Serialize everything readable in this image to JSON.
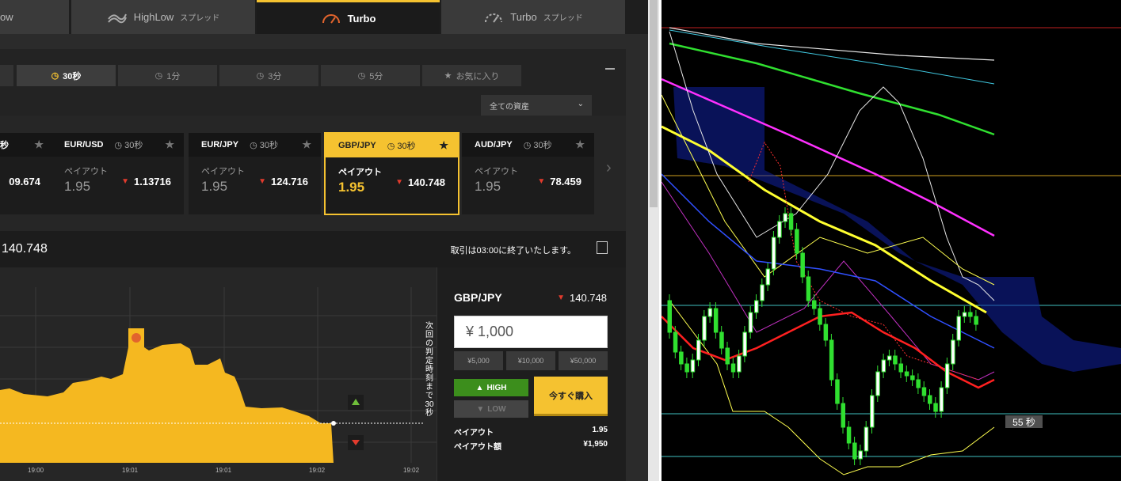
{
  "top_tabs": [
    {
      "label": "ow",
      "sub": ""
    },
    {
      "label": "HighLow",
      "sub": "スプレッド"
    },
    {
      "label": "Turbo",
      "sub": ""
    },
    {
      "label": "Turbo",
      "sub": "スプレッド"
    }
  ],
  "durations": [
    {
      "label": "30秒"
    },
    {
      "label": "1分"
    },
    {
      "label": "3分"
    },
    {
      "label": "5分"
    },
    {
      "label": "お気に入り"
    }
  ],
  "asset_filter": "全ての資産",
  "assets": [
    {
      "pair": "",
      "duration": "秒",
      "payout_label": "",
      "payout": "",
      "rate": "09.674"
    },
    {
      "pair": "EUR/USD",
      "duration": "30秒",
      "payout_label": "ペイアウト",
      "payout": "1.95",
      "rate": "1.13716"
    },
    {
      "pair": "EUR/JPY",
      "duration": "30秒",
      "payout_label": "ペイアウト",
      "payout": "1.95",
      "rate": "124.716"
    },
    {
      "pair": "GBP/JPY",
      "duration": "30秒",
      "payout_label": "ペイアウト",
      "payout": "1.95",
      "rate": "140.748"
    },
    {
      "pair": "AUD/JPY",
      "duration": "30秒",
      "payout_label": "ペイアウト",
      "payout": "1.95",
      "rate": "78.459"
    }
  ],
  "info": {
    "price": "140.748",
    "close_text": "取引は03:00に終了いたします。"
  },
  "chart": {
    "time_labels": [
      "19:00",
      "19:01",
      "19:01",
      "19:02",
      "19:02"
    ],
    "vertical_text": "次回の判定時刻まで30秒"
  },
  "order": {
    "pair": "GBP/JPY",
    "rate": "140.748",
    "amount": "¥ 1,000",
    "quick": [
      "¥5,000",
      "¥10,000",
      "¥50,000"
    ],
    "high": "HIGH",
    "low": "LOW",
    "buy": "今すぐ購入",
    "payout_label": "ペイアウト",
    "payout": "1.95",
    "payout_amount_label": "ペイアウト額",
    "payout_amount": "¥1,950"
  },
  "mt4": {
    "timer": "55 秒"
  },
  "colors": {
    "accent": "#f5c230",
    "high": "#3c8e1c",
    "down": "#e23b2d"
  }
}
